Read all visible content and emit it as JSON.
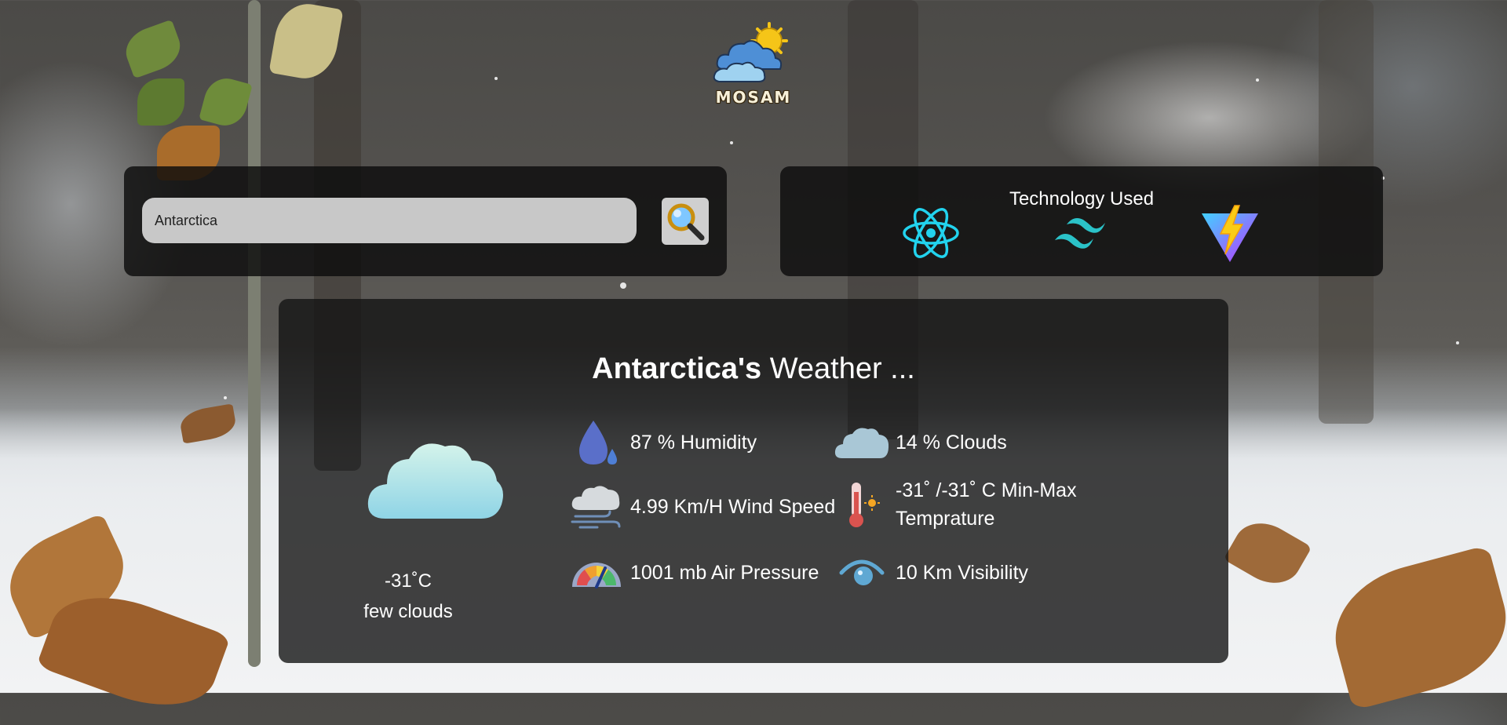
{
  "app": {
    "logo_text": "MOSAM"
  },
  "search": {
    "value": "Antarctica",
    "button_icon": "search-icon"
  },
  "technology": {
    "title": "Technology Used",
    "icons": [
      "react-icon",
      "tailwind-icon",
      "vite-icon"
    ]
  },
  "weather": {
    "title_city": "Antarctica's",
    "title_rest": " Weather ...",
    "temperature": "-31˚C",
    "description": "few clouds",
    "condition_icon": "cloud-icon",
    "stats": [
      {
        "icon": "droplet-icon",
        "text": "87 % Humidity"
      },
      {
        "icon": "cloud-icon",
        "text": "14 % Clouds"
      },
      {
        "icon": "wind-icon",
        "text": "4.99 Km/H Wind Speed"
      },
      {
        "icon": "thermometer-icon",
        "line1": "-31˚ /-31˚ C Min-Max",
        "line2": "Temprature"
      },
      {
        "icon": "gauge-icon",
        "text": "1001 mb Air Pressure"
      },
      {
        "icon": "eye-icon",
        "text": "10 Km Visibility"
      }
    ]
  },
  "colors": {
    "panel_bg": "#0c0c0c",
    "input_bg": "#c8c8c8",
    "react": "#22d3ee",
    "tailwind": "#38bdf8",
    "vite_purple": "#a855f7",
    "vite_yellow": "#facc15"
  }
}
